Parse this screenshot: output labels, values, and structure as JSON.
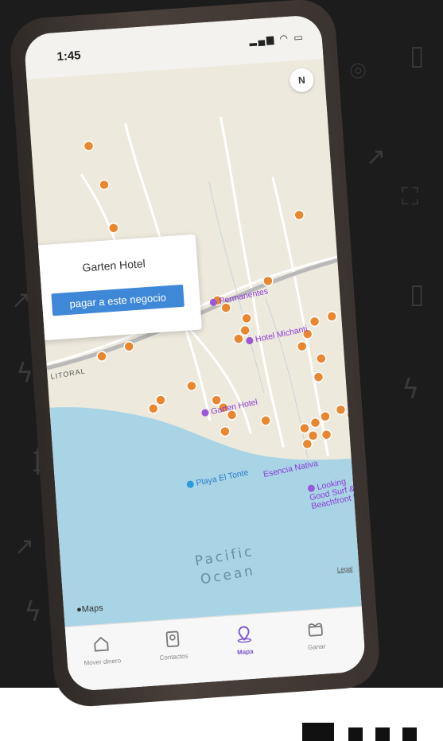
{
  "status": {
    "time": "1:45",
    "icons": "signal-wifi-battery"
  },
  "map": {
    "compass_label": "N",
    "road_label": "LITORAL",
    "pois": [
      {
        "label": "Permanentes",
        "kind": "hotel"
      },
      {
        "label": "Hotel Michanti",
        "kind": "hotel"
      },
      {
        "label": "Garten Hotel",
        "kind": "hotel"
      },
      {
        "label": "Playa El Tonte",
        "kind": "beach"
      },
      {
        "label": "Esencia Nativa",
        "kind": "hotel"
      },
      {
        "label": "Looking Good Surf & Beachfront Ho",
        "kind": "hotel"
      }
    ],
    "ocean_line1": "Pacific",
    "ocean_line2": "Ocean",
    "legal_label": "Legal",
    "brand": "Maps",
    "accent_pin": "#e8872f",
    "water": "#a9d4e6",
    "land": "#eee9dd"
  },
  "popup": {
    "title": "Garten Hotel",
    "button_label": "pagar a este negocio",
    "button_color": "#3f88d8"
  },
  "tabs": [
    {
      "label": "Mover dinero",
      "icon": "home-icon",
      "active": false
    },
    {
      "label": "Contactos",
      "icon": "contacts-icon",
      "active": false
    },
    {
      "label": "Mapa",
      "icon": "map-pin-icon",
      "active": true
    },
    {
      "label": "Ganar",
      "icon": "gift-icon",
      "active": false
    }
  ],
  "accent_active": "#7a4fd0"
}
